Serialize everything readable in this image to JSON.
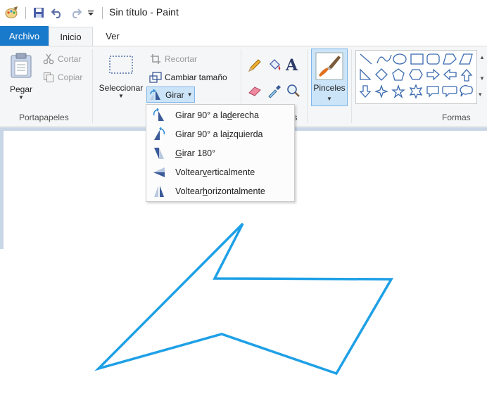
{
  "window": {
    "title": "Sin título - Paint"
  },
  "quick_access": {
    "icons": [
      "paint-app-icon",
      "save-icon",
      "undo-icon",
      "redo-icon",
      "customize-dropdown-icon"
    ]
  },
  "tabs": [
    {
      "label": "Archivo"
    },
    {
      "label": "Inicio"
    },
    {
      "label": "Ver"
    }
  ],
  "ribbon": {
    "clipboard": {
      "label": "Portapapeles",
      "paste": "Pegar",
      "cut": "Cortar",
      "copy": "Copiar"
    },
    "image": {
      "select": "Seleccionar",
      "crop": "Recortar",
      "resize": "Cambiar tamaño",
      "rotate": "Girar"
    },
    "tools": {
      "label_tail": "as"
    },
    "brushes": {
      "label": "Pinceles"
    },
    "shapes": {
      "label": "Formas"
    }
  },
  "rotate_menu": {
    "items": [
      {
        "prefix": "Girar 90° a la ",
        "key": "d",
        "suffix": "erecha",
        "icon": "rotate-right-90-icon"
      },
      {
        "prefix": "Girar 90° a la ",
        "key": "i",
        "suffix": "zquierda",
        "icon": "rotate-left-90-icon"
      },
      {
        "prefix": "",
        "key": "G",
        "suffix": "irar 180°",
        "icon": "rotate-180-icon"
      },
      {
        "prefix": "Voltear ",
        "key": "v",
        "suffix": "erticalmente",
        "icon": "flip-vertical-icon"
      },
      {
        "prefix": "Voltear ",
        "key": "h",
        "suffix": "orizontalmente",
        "icon": "flip-horizontal-icon"
      }
    ]
  },
  "drawing": {
    "stroke_color": "#1ea0e6"
  },
  "colors": {
    "accent": "#1979ca",
    "selected_bg": "#cce4f7",
    "selected_border": "#7eb4ea"
  }
}
